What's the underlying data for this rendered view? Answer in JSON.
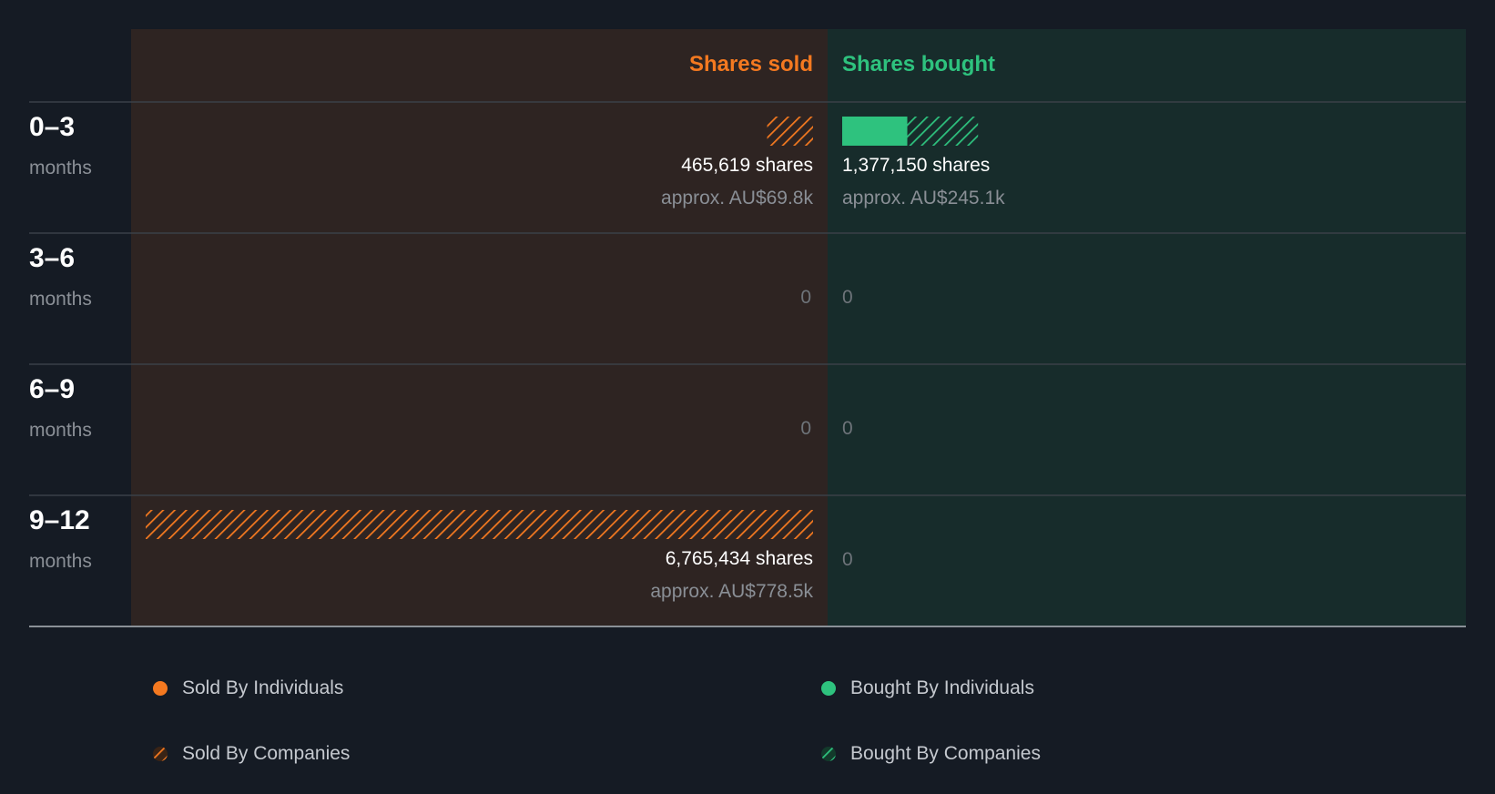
{
  "colors": {
    "background": "#151b24",
    "sold_panel": "#2e2422",
    "bought_panel": "#172c2b",
    "sold": "#f47920",
    "bought": "#2ec27e",
    "divider": "#3a4048",
    "axis": "#8a9097",
    "muted_text": "#8a8f96",
    "zero_text": "#6e747a",
    "value_text": "#ffffff"
  },
  "legend": {
    "sold_individuals": "Sold By Individuals",
    "bought_individuals": "Bought By Individuals",
    "sold_companies": "Sold By Companies",
    "bought_companies": "Bought By Companies"
  },
  "chart_data": {
    "type": "bar",
    "orientation": "horizontal-diverging",
    "sold_header": "Shares sold",
    "bought_header": "Shares bought",
    "max_value": 6765434,
    "categories": [
      {
        "range": "0–3",
        "unit": "months",
        "sold": {
          "individuals": 0,
          "companies": 465619,
          "shares_label": "465,619 shares",
          "approx_label": "approx. AU$69.8k",
          "zero_label": ""
        },
        "bought": {
          "individuals": 660000,
          "companies": 717150,
          "shares_label": "1,377,150 shares",
          "approx_label": "approx. AU$245.1k",
          "zero_label": ""
        }
      },
      {
        "range": "3–6",
        "unit": "months",
        "sold": {
          "individuals": 0,
          "companies": 0,
          "shares_label": "",
          "approx_label": "",
          "zero_label": "0"
        },
        "bought": {
          "individuals": 0,
          "companies": 0,
          "shares_label": "",
          "approx_label": "",
          "zero_label": "0"
        }
      },
      {
        "range": "6–9",
        "unit": "months",
        "sold": {
          "individuals": 0,
          "companies": 0,
          "shares_label": "",
          "approx_label": "",
          "zero_label": "0"
        },
        "bought": {
          "individuals": 0,
          "companies": 0,
          "shares_label": "",
          "approx_label": "",
          "zero_label": "0"
        }
      },
      {
        "range": "9–12",
        "unit": "months",
        "sold": {
          "individuals": 0,
          "companies": 6765434,
          "shares_label": "6,765,434 shares",
          "approx_label": "approx. AU$778.5k",
          "zero_label": ""
        },
        "bought": {
          "individuals": 0,
          "companies": 0,
          "shares_label": "",
          "approx_label": "",
          "zero_label": "0"
        }
      }
    ]
  }
}
